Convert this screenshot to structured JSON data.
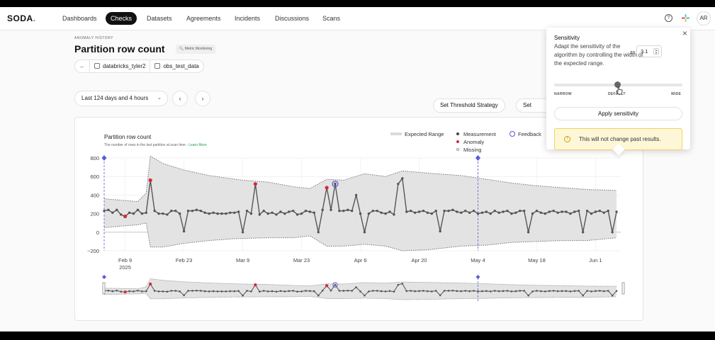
{
  "nav": {
    "logo": "SODA",
    "items": [
      "Dashboards",
      "Checks",
      "Datasets",
      "Agreements",
      "Incidents",
      "Discussions",
      "Scans"
    ],
    "active": "Checks",
    "avatar": "AR"
  },
  "header": {
    "eyebrow": "ANOMALY HISTORY",
    "title": "Partition row count",
    "tag": "Metric Monitoring",
    "breadcrumb": {
      "datasource": "databricks_tyler2",
      "dataset": "obs_test_data"
    }
  },
  "controls": {
    "date_range": "Last 124 days and 4 hours",
    "threshold_button": "Set Threshold Strategy",
    "exclusion_button": "Set Excl"
  },
  "chart": {
    "subtitle": "The number of rows in the last partition at scan time - ",
    "learn_more": "Learn More",
    "legend": {
      "expected_range": "Expected Range",
      "measurement": "Measurement",
      "anomaly": "Anomaly",
      "missing": "Missing",
      "feedback": "Feedback"
    }
  },
  "chart_data": {
    "type": "line",
    "title": "Partition row count",
    "ylim": [
      -200,
      800
    ],
    "yticks": [
      "800",
      "600",
      "400",
      "200",
      "0",
      "−200"
    ],
    "xticks": [
      {
        "t": 4,
        "label": "Feb 9",
        "sub": "2025"
      },
      {
        "t": 18,
        "label": "Feb 23"
      },
      {
        "t": 32,
        "label": "Mar 9"
      },
      {
        "t": 46,
        "label": "Mar 23"
      },
      {
        "t": 60,
        "label": "Apr 6"
      },
      {
        "t": 74,
        "label": "Apr 20"
      },
      {
        "t": 88,
        "label": "May 4"
      },
      {
        "t": 102,
        "label": "May 18"
      },
      {
        "t": 116,
        "label": "Jun 1"
      }
    ],
    "x_range": [
      -1,
      122
    ],
    "measurements": [
      [
        -1,
        230
      ],
      [
        0,
        240
      ],
      [
        1,
        210
      ],
      [
        2,
        240
      ],
      [
        3,
        190
      ],
      [
        4,
        170
      ],
      [
        5,
        210
      ],
      [
        6,
        200
      ],
      [
        7,
        240
      ],
      [
        8,
        200
      ],
      [
        9,
        210
      ],
      [
        10,
        560
      ],
      [
        11,
        230
      ],
      [
        12,
        200
      ],
      [
        13,
        200
      ],
      [
        14,
        190
      ],
      [
        15,
        230
      ],
      [
        16,
        230
      ],
      [
        17,
        200
      ],
      [
        18,
        10
      ],
      [
        19,
        230
      ],
      [
        20,
        230
      ],
      [
        21,
        240
      ],
      [
        22,
        230
      ],
      [
        23,
        210
      ],
      [
        24,
        200
      ],
      [
        25,
        210
      ],
      [
        26,
        200
      ],
      [
        27,
        200
      ],
      [
        28,
        200
      ],
      [
        29,
        210
      ],
      [
        30,
        210
      ],
      [
        31,
        220
      ],
      [
        32,
        0
      ],
      [
        33,
        230
      ],
      [
        34,
        200
      ],
      [
        35,
        520
      ],
      [
        36,
        190
      ],
      [
        37,
        230
      ],
      [
        38,
        200
      ],
      [
        39,
        210
      ],
      [
        40,
        190
      ],
      [
        41,
        220
      ],
      [
        42,
        200
      ],
      [
        43,
        220
      ],
      [
        44,
        230
      ],
      [
        45,
        190
      ],
      [
        46,
        200
      ],
      [
        47,
        230
      ],
      [
        48,
        220
      ],
      [
        49,
        210
      ],
      [
        50,
        0
      ],
      [
        51,
        240
      ],
      [
        52,
        480
      ],
      [
        53,
        240
      ],
      [
        54,
        520
      ],
      [
        55,
        230
      ],
      [
        56,
        230
      ],
      [
        57,
        240
      ],
      [
        58,
        230
      ],
      [
        59,
        400
      ],
      [
        60,
        200
      ],
      [
        61,
        0
      ],
      [
        62,
        200
      ],
      [
        63,
        230
      ],
      [
        64,
        230
      ],
      [
        65,
        210
      ],
      [
        66,
        200
      ],
      [
        67,
        220
      ],
      [
        68,
        190
      ],
      [
        69,
        520
      ],
      [
        70,
        580
      ],
      [
        71,
        220
      ],
      [
        72,
        230
      ],
      [
        73,
        210
      ],
      [
        74,
        220
      ],
      [
        75,
        230
      ],
      [
        76,
        210
      ],
      [
        77,
        200
      ],
      [
        78,
        230
      ],
      [
        79,
        10
      ],
      [
        80,
        230
      ],
      [
        81,
        230
      ],
      [
        82,
        240
      ],
      [
        83,
        220
      ],
      [
        84,
        210
      ],
      [
        85,
        230
      ],
      [
        86,
        210
      ],
      [
        87,
        230
      ],
      [
        88,
        200
      ],
      [
        89,
        210
      ],
      [
        90,
        220
      ],
      [
        91,
        200
      ],
      [
        92,
        230
      ],
      [
        93,
        210
      ],
      [
        94,
        220
      ],
      [
        95,
        230
      ],
      [
        96,
        200
      ],
      [
        97,
        210
      ],
      [
        98,
        230
      ],
      [
        99,
        230
      ],
      [
        100,
        0
      ],
      [
        101,
        200
      ],
      [
        102,
        230
      ],
      [
        103,
        210
      ],
      [
        104,
        200
      ],
      [
        105,
        220
      ],
      [
        106,
        230
      ],
      [
        107,
        210
      ],
      [
        108,
        220
      ],
      [
        109,
        220
      ],
      [
        110,
        200
      ],
      [
        111,
        220
      ],
      [
        112,
        230
      ],
      [
        113,
        0
      ],
      [
        114,
        230
      ],
      [
        115,
        200
      ],
      [
        116,
        220
      ],
      [
        117,
        230
      ],
      [
        118,
        210
      ],
      [
        119,
        230
      ],
      [
        120,
        0
      ],
      [
        121,
        220
      ]
    ],
    "anomalies": [
      [
        4,
        170
      ],
      [
        10,
        560
      ],
      [
        35,
        520
      ],
      [
        52,
        480
      ]
    ],
    "feedback": [
      [
        54,
        520
      ]
    ],
    "upper": [
      [
        -1,
        360
      ],
      [
        7,
        330
      ],
      [
        9,
        420
      ],
      [
        10,
        820
      ],
      [
        13,
        740
      ],
      [
        18,
        670
      ],
      [
        24,
        610
      ],
      [
        32,
        560
      ],
      [
        38,
        540
      ],
      [
        44,
        490
      ],
      [
        48,
        470
      ],
      [
        52,
        570
      ],
      [
        56,
        560
      ],
      [
        61,
        630
      ],
      [
        66,
        600
      ],
      [
        70,
        660
      ],
      [
        78,
        630
      ],
      [
        84,
        610
      ],
      [
        90,
        570
      ],
      [
        96,
        530
      ],
      [
        102,
        500
      ],
      [
        108,
        480
      ],
      [
        114,
        460
      ],
      [
        121,
        450
      ]
    ],
    "lower": [
      [
        -1,
        50
      ],
      [
        7,
        80
      ],
      [
        9,
        100
      ],
      [
        10,
        -160
      ],
      [
        13,
        -160
      ],
      [
        18,
        -120
      ],
      [
        24,
        -90
      ],
      [
        30,
        -70
      ],
      [
        38,
        -60
      ],
      [
        44,
        -60
      ],
      [
        48,
        -40
      ],
      [
        52,
        -150
      ],
      [
        56,
        -150
      ],
      [
        61,
        -130
      ],
      [
        66,
        -150
      ],
      [
        70,
        -200
      ],
      [
        76,
        -190
      ],
      [
        84,
        -150
      ],
      [
        90,
        -140
      ],
      [
        96,
        -110
      ],
      [
        102,
        -100
      ],
      [
        108,
        -90
      ],
      [
        114,
        -90
      ],
      [
        121,
        -60
      ]
    ]
  },
  "popover": {
    "title": "Sensitivity",
    "description": "Adapt the sensitivity of the algorithm by controlling the width of the expected range.",
    "z_label": "z=",
    "z_value": "3.1",
    "narrow": "NARROW",
    "default": "DEFAULT",
    "wide": "WIDE",
    "apply": "Apply sensitivity",
    "warning": "This will not change past results."
  },
  "colors": {
    "accent": "#5b5bd6",
    "anomaly": "#d9263f",
    "band": "#dcdcdc",
    "success": "#16a34a"
  }
}
